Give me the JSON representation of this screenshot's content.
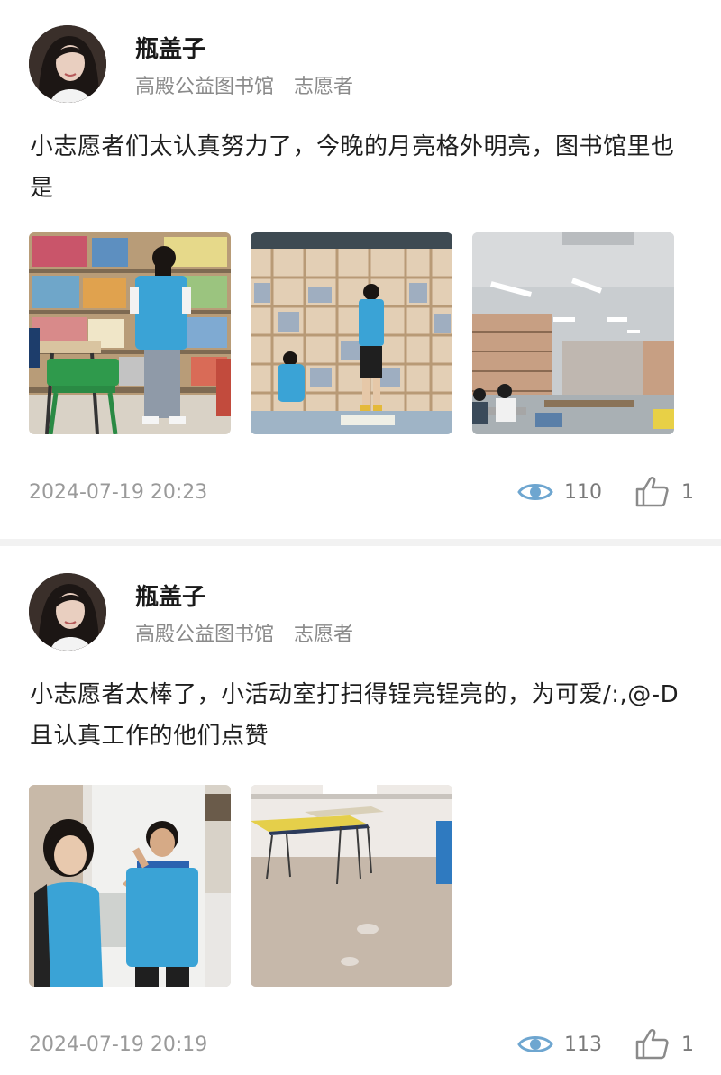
{
  "posts": [
    {
      "author": "瓶盖子",
      "org": "高殿公益图书馆",
      "role": "志愿者",
      "text": "小志愿者们太认真努力了，今晚的月亮格外明亮，图书馆里也是",
      "time": "2024-07-19 20:23",
      "views": "110",
      "likes": "1",
      "photos": [
        "volunteers-shelving-books",
        "volunteers-organizing-shelves",
        "library-reading-room"
      ]
    },
    {
      "author": "瓶盖子",
      "org": "高殿公益图书馆",
      "role": "志愿者",
      "text": "小志愿者太棒了，小活动室打扫得锃亮锃亮的，为可爱/:,@-D且认真工作的他们点赞",
      "time": "2024-07-19 20:19",
      "views": "113",
      "likes": "1",
      "photos": [
        "child-volunteers-posing",
        "cleaned-activity-room"
      ]
    }
  ],
  "colors": {
    "vest": "#3aa3d6",
    "separator": "#f2f2f2",
    "meta": "#8a8a8a"
  },
  "icons": [
    "eye-icon",
    "thumbs-up-icon"
  ]
}
